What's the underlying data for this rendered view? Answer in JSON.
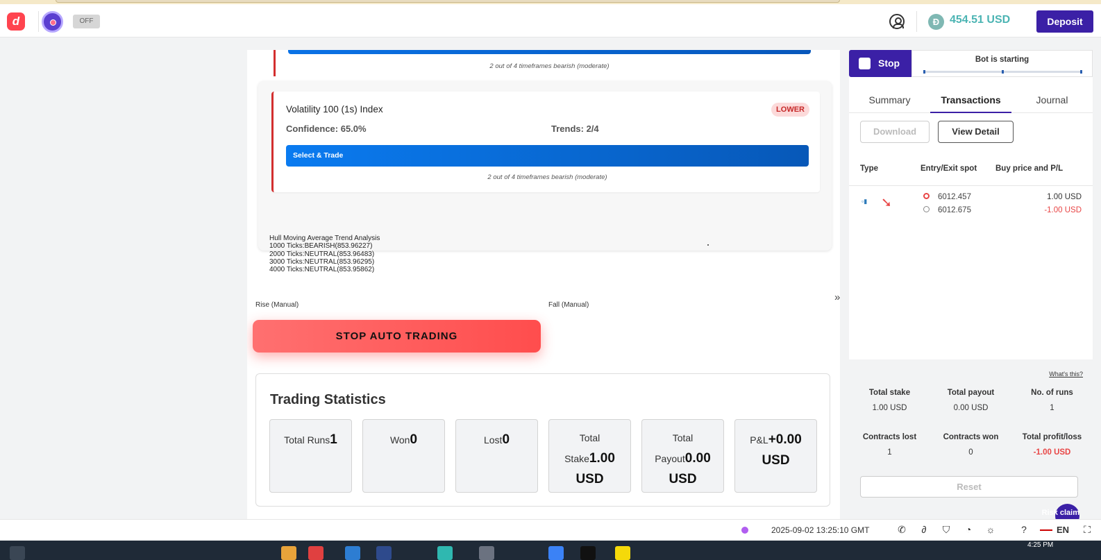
{
  "header": {
    "logo_letter": "d",
    "bot_toggle_label": "OFF",
    "balance": "454.51 USD",
    "currency_symbol": "Đ",
    "deposit_label": "Deposit"
  },
  "main": {
    "top_card_note": "2 out of 4 timeframes bearish (moderate)",
    "card": {
      "title": "Volatility 100 (1s) Index",
      "badge": "LOWER",
      "confidence": "Confidence: 65.0%",
      "trends": "Trends: 2/4",
      "select_trade_label": "Select & Trade",
      "note": "2 out of 4 timeframes bearish (moderate)"
    },
    "hull": {
      "title": "Hull Moving Average Trend Analysis",
      "lines": [
        "1000 Ticks:BEARISH(853.96227)",
        "2000 Ticks:NEUTRAL(853.96483)",
        "3000 Ticks:NEUTRAL(853.96295)",
        "4000 Ticks:NEUTRAL(853.95862)"
      ]
    },
    "rise_label": "Rise (Manual)",
    "fall_label": "Fall (Manual)",
    "stop_auto_label": "STOP AUTO TRADING",
    "stats": {
      "title": "Trading Statistics",
      "boxes": [
        {
          "label": "Total Runs",
          "value": "1"
        },
        {
          "label": "Won",
          "value": "0"
        },
        {
          "label": "Lost",
          "value": "0"
        },
        {
          "label": "Total Stake",
          "value": "1.00 USD"
        },
        {
          "label": "Total Payout",
          "value": "0.00 USD"
        },
        {
          "label": "P&L",
          "value": "+0.00 USD"
        }
      ]
    }
  },
  "panel": {
    "stop_label": "Stop",
    "bot_status": "Bot is starting",
    "tabs": [
      "Summary",
      "Transactions",
      "Journal"
    ],
    "download_label": "Download",
    "view_detail_label": "View Detail",
    "columns": [
      "Type",
      "Entry/Exit spot",
      "Buy price and P/L"
    ],
    "transaction": {
      "entry_spot": "6012.457",
      "exit_spot": "6012.675",
      "buy_price": "1.00 USD",
      "pl": "-1.00 USD"
    },
    "whats_this": "What's this?",
    "summary": [
      {
        "label": "Total stake",
        "value": "1.00 USD"
      },
      {
        "label": "Total payout",
        "value": "0.00 USD"
      },
      {
        "label": "No. of runs",
        "value": "1"
      },
      {
        "label": "Contracts lost",
        "value": "1"
      },
      {
        "label": "Contracts won",
        "value": "0"
      },
      {
        "label": "Total profit/loss",
        "value": "-1.00 USD"
      }
    ],
    "reset_label": "Reset",
    "risk_text": "Risk claim"
  },
  "statusbar": {
    "datetime": "2025-09-02 13:25:10 GMT",
    "language": "EN"
  },
  "taskbar": {
    "time": "4:25 PM"
  },
  "colors": {
    "brand_purple": "#3b20a6",
    "loss_red": "#e84545",
    "balance_teal": "#4bb4b3"
  }
}
